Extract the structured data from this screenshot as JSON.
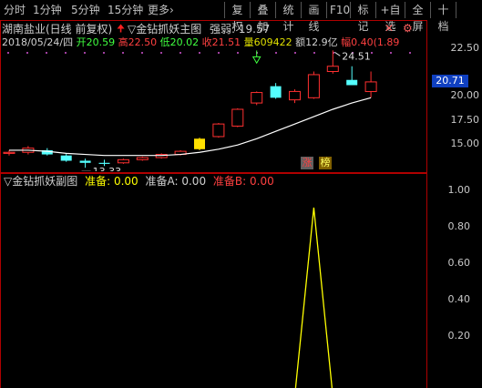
{
  "toolbar": {
    "tabs": [
      "分时",
      "1分钟",
      "5分钟",
      "15分钟",
      "更多"
    ],
    "more_arrow": "›",
    "buttons": [
      "复权",
      "叠加",
      "统计",
      "画线",
      "F10",
      "标记",
      "+自选",
      "全屏",
      "十档"
    ]
  },
  "main_panel": {
    "title": "湖南盐业(日线 前复权)",
    "indicator": "▽金钻抓妖主图",
    "strength_label": "强弱: 19.57",
    "date": "2018/05/24/四",
    "open": "开20.59",
    "high": "高22.50",
    "low": "低20.02",
    "close": "收21.51",
    "volume": "量609422",
    "amount": "额12.9亿",
    "change": "幅0.40(1.89",
    "close_tag": "20.71",
    "high_mark": "24.51",
    "low_mark": "13.33",
    "tag_rise": "涨",
    "tag_list": "榜",
    "y_ticks": [
      "22.50",
      "20.00",
      "17.50",
      "15.00"
    ]
  },
  "sub_panel": {
    "title": "▽金钻抓妖副图",
    "zb_label": "准备:",
    "zb_value": "0.00",
    "zba_label": "准备A:",
    "zba_value": "0.00",
    "zbb_label": "准备B:",
    "zbb_value": "0.00",
    "y_ticks": [
      "1.00",
      "0.80",
      "0.60",
      "0.40",
      "0.20"
    ]
  },
  "colors": {
    "up": "#ff3030",
    "down": "#54ffff",
    "ma": "#ffffff",
    "signal": "#ffff00",
    "grid_frame": "#b00000"
  },
  "chart_data": [
    {
      "type": "candlestick",
      "title": "湖南盐业(日线 前复权)",
      "y_ticks": [
        15.0,
        17.5,
        20.0,
        22.5
      ],
      "ylim": [
        13.0,
        24.8
      ],
      "candles": [
        {
          "o": 14.7,
          "h": 15.0,
          "l": 14.5,
          "c": 14.8
        },
        {
          "o": 14.8,
          "h": 15.4,
          "l": 14.6,
          "c": 15.2
        },
        {
          "o": 15.0,
          "h": 15.2,
          "l": 14.5,
          "c": 14.6
        },
        {
          "o": 14.5,
          "h": 14.7,
          "l": 13.9,
          "c": 14.0
        },
        {
          "o": 14.0,
          "h": 14.2,
          "l": 13.33,
          "c": 13.8
        },
        {
          "o": 13.8,
          "h": 14.1,
          "l": 13.5,
          "c": 13.7
        },
        {
          "o": 13.8,
          "h": 14.2,
          "l": 13.7,
          "c": 14.1
        },
        {
          "o": 14.1,
          "h": 14.4,
          "l": 14.0,
          "c": 14.3
        },
        {
          "o": 14.3,
          "h": 14.7,
          "l": 14.2,
          "c": 14.6
        },
        {
          "o": 14.6,
          "h": 15.0,
          "l": 14.5,
          "c": 14.9
        },
        {
          "o": 15.1,
          "h": 16.2,
          "l": 15.0,
          "c": 16.1
        },
        {
          "o": 16.3,
          "h": 17.6,
          "l": 16.2,
          "c": 17.5
        },
        {
          "o": 17.3,
          "h": 19.0,
          "l": 17.2,
          "c": 18.9
        },
        {
          "o": 19.5,
          "h": 20.6,
          "l": 19.3,
          "c": 20.5
        },
        {
          "o": 21.1,
          "h": 21.4,
          "l": 19.9,
          "c": 20.0
        },
        {
          "o": 19.8,
          "h": 20.8,
          "l": 19.5,
          "c": 20.6
        },
        {
          "o": 20.0,
          "h": 22.5,
          "l": 19.9,
          "c": 22.2
        },
        {
          "o": 22.5,
          "h": 24.51,
          "l": 22.3,
          "c": 23.0
        },
        {
          "o": 21.7,
          "h": 23.0,
          "l": 21.2,
          "c": 21.2
        },
        {
          "o": 20.59,
          "h": 22.5,
          "l": 20.02,
          "c": 21.51
        }
      ],
      "ma_series": [
        15.0,
        15.0,
        14.9,
        14.7,
        14.6,
        14.5,
        14.5,
        14.5,
        14.5,
        14.6,
        14.8,
        15.1,
        15.5,
        16.1,
        16.8,
        17.5,
        18.2,
        18.9,
        19.5,
        20.0
      ],
      "marks": {
        "high": 24.51,
        "low": 13.33
      }
    },
    {
      "type": "line",
      "title": "▽金钻抓妖副图",
      "y_ticks": [
        0.2,
        0.4,
        0.6,
        0.8,
        1.0
      ],
      "ylim": [
        0,
        1.1
      ],
      "series": [
        {
          "name": "准备",
          "values": [
            0,
            0,
            0,
            0,
            0,
            0,
            0,
            0,
            0,
            0,
            0,
            0,
            0,
            0,
            0,
            0,
            1,
            0,
            0,
            0
          ]
        }
      ]
    }
  ]
}
